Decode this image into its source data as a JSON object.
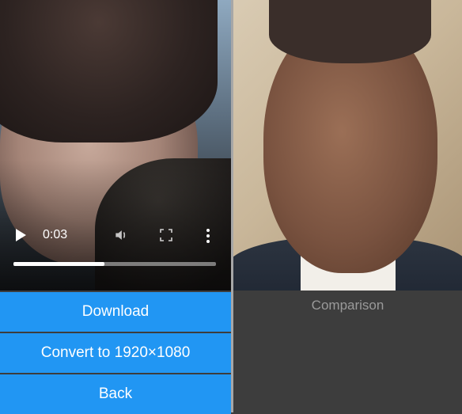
{
  "video": {
    "current_time": "0:03",
    "progress": 0.45,
    "icons": [
      "play-icon",
      "volume-icon",
      "fullscreen-icon",
      "more-options-icon"
    ]
  },
  "buttons": {
    "download": "Download",
    "convert": "Convert to 1920×1080",
    "back": "Back"
  },
  "comparison": {
    "label": "Comparison"
  },
  "colors": {
    "button_bg": "#2196f3",
    "panel_bg": "#3d3d3d",
    "label_text": "#9a9a9a"
  }
}
